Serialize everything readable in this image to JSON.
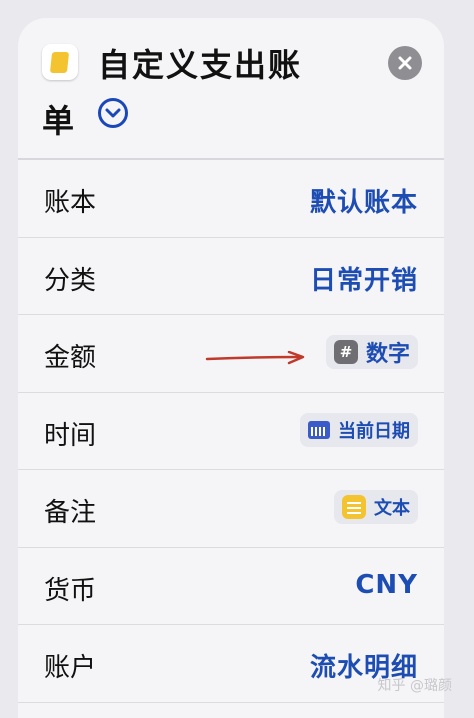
{
  "header": {
    "title_line1": "自定义支出账",
    "title_line2": "单"
  },
  "rows": [
    {
      "label": "账本",
      "value": "默认账本"
    },
    {
      "label": "分类",
      "value": "日常开销"
    },
    {
      "label": "金额",
      "value": "数字",
      "icon": "hash-icon"
    },
    {
      "label": "时间",
      "value": "当前日期",
      "icon": "calendar-icon"
    },
    {
      "label": "备注",
      "value": "文本",
      "icon": "note-icon"
    },
    {
      "label": "货币",
      "value": "CNY"
    },
    {
      "label": "账户",
      "value": "流水明细"
    }
  ],
  "watermark": "知乎 @璐颜",
  "colors": {
    "accent": "#1d4db3",
    "arrow": "#c0392b",
    "note": "#f4c430"
  }
}
